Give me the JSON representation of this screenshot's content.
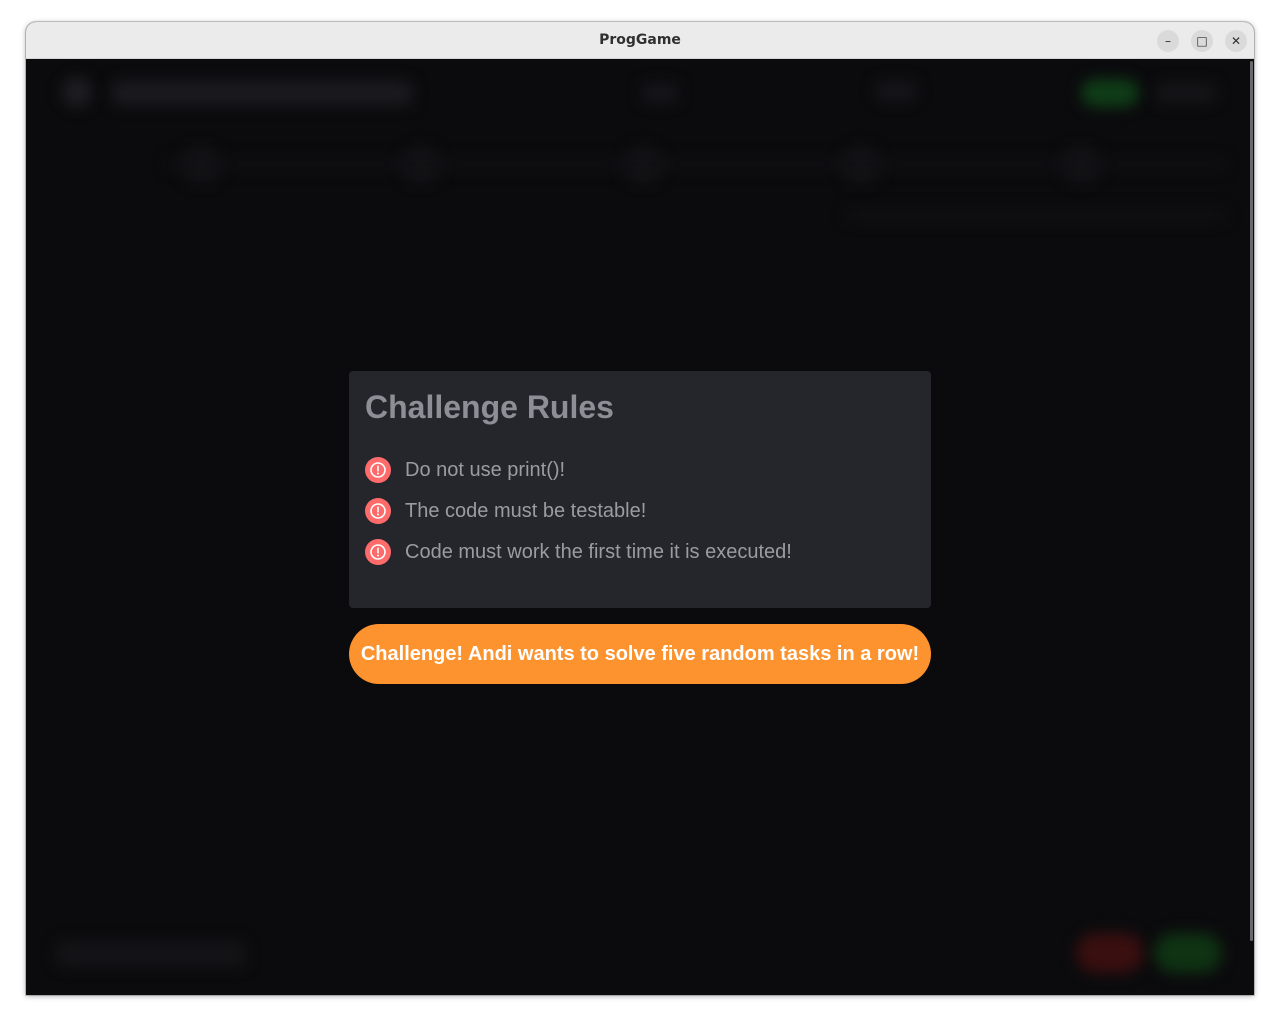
{
  "window": {
    "title": "ProgGame",
    "controls": {
      "minimize": "–",
      "maximize": "□",
      "close": "✕"
    }
  },
  "dialog": {
    "title": "Challenge Rules",
    "rules": [
      {
        "icon": "alert-circle-icon",
        "text": "Do not use print()!"
      },
      {
        "icon": "alert-circle-icon",
        "text": "The code must be testable!"
      },
      {
        "icon": "alert-circle-icon",
        "text": "Code must work the first time it is executed!"
      }
    ],
    "action_label": "Challenge! Andi wants to solve five random tasks in a row!"
  },
  "colors": {
    "panel_bg": "#25262b",
    "page_bg": "#0b0b0d",
    "alert": "#ff6b6b",
    "action_button": "#fd932e"
  }
}
